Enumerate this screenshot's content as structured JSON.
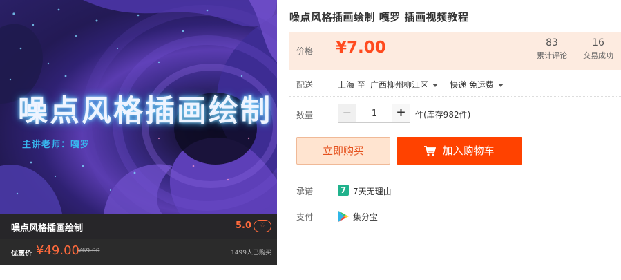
{
  "card": {
    "hero_title": "噪点风格插画绘制",
    "hero_subtitle": "主讲老师：嘎罗",
    "name": "噪点风格插画绘制",
    "score": "5.0",
    "heart_icon": "heart-icon",
    "promo_label": "优惠价",
    "promo_price": "¥49.00",
    "original_price": "¥69.00",
    "bought_count": "1499人已购买"
  },
  "product": {
    "title": "噪点风格插画绘制 嘎罗 插画视频教程"
  },
  "price": {
    "label": "价格",
    "value": "¥7.00",
    "reviews_count": "83",
    "reviews_label": "累计评论",
    "deals_count": "16",
    "deals_label": "交易成功"
  },
  "shipping": {
    "label": "配送",
    "from": "上海 至",
    "to": "广西柳州柳江区",
    "method": "快递 免运费"
  },
  "quantity": {
    "label": "数量",
    "minus": "−",
    "value": "1",
    "plus": "+",
    "stock": "件(库存982件)"
  },
  "actions": {
    "buy_now": "立即购买",
    "add_to_cart": "加入购物车",
    "cart_icon": "cart-icon"
  },
  "promise": {
    "label": "承诺",
    "icon_text": "7",
    "text": "7天无理由"
  },
  "payment": {
    "label": "支付",
    "icon": "play-store-icon",
    "text": "集分宝"
  },
  "colors": {
    "accent": "#ff4200",
    "price": "#ff4a1e",
    "price_bg": "#fdebe0",
    "promise_green": "#20b28c"
  }
}
